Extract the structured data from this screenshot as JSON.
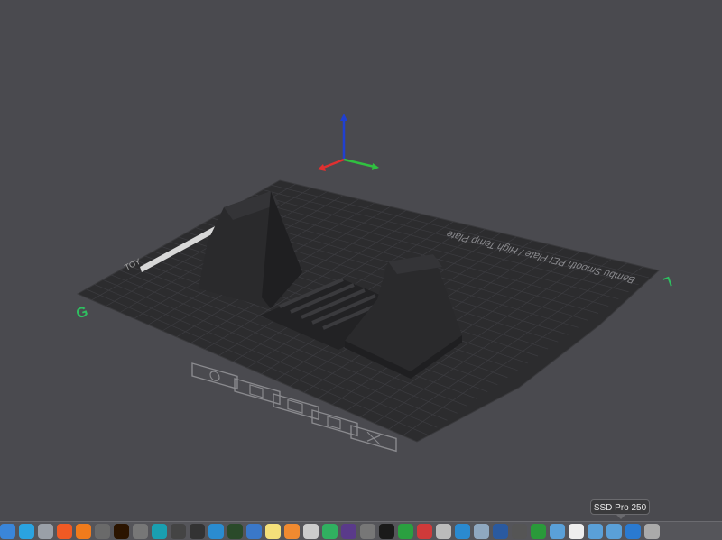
{
  "viewport": {
    "background": "#4a4a4f",
    "bed_label": "Bambu Smooth PEI Plate / High Temp Plate",
    "bed_corner_label": "TOY",
    "bed_colors": {
      "plate": "#2c2c2e",
      "grid": "#3c3c40",
      "model": "#2a2a2c"
    },
    "axis_colors": {
      "x": "#e03030",
      "y": "#30c040",
      "z": "#2040d0"
    },
    "plate_tools": [
      {
        "name": "orient-icon"
      },
      {
        "name": "arrange-icon"
      },
      {
        "name": "slice-plate-icon"
      },
      {
        "name": "settings-icon"
      },
      {
        "name": "close-icon"
      }
    ]
  },
  "tooltip": {
    "text": "SSD Pro 250"
  },
  "dock": {
    "items": [
      {
        "name": "finder-icon",
        "color": "#3a86d9"
      },
      {
        "name": "telegram-icon",
        "color": "#2aa3e0"
      },
      {
        "name": "launchpad-icon",
        "color": "#9aa0a8"
      },
      {
        "name": "brave-icon",
        "color": "#f05a24"
      },
      {
        "name": "firefox-icon",
        "color": "#f07b1c"
      },
      {
        "name": "screen-recorder-icon",
        "color": "#6a6a6a"
      },
      {
        "name": "illustrator-icon",
        "color": "#2b1400"
      },
      {
        "name": "tool-icon",
        "color": "#777"
      },
      {
        "name": "view-icon",
        "color": "#1a9fb0"
      },
      {
        "name": "block-icon",
        "color": "#444"
      },
      {
        "name": "piano-icon",
        "color": "#333"
      },
      {
        "name": "wifi-icon",
        "color": "#2a8cd0"
      },
      {
        "name": "audio-icon",
        "color": "#2a4a2a"
      },
      {
        "name": "sw-icon",
        "color": "#3a78c9"
      },
      {
        "name": "notes-icon",
        "color": "#f4e07a"
      },
      {
        "name": "finder-f-icon",
        "color": "#f08a30"
      },
      {
        "name": "text-icon",
        "color": "#ccc"
      },
      {
        "name": "green-app-icon",
        "color": "#30b060"
      },
      {
        "name": "orbit-icon",
        "color": "#5a3a8a"
      },
      {
        "name": "compass-icon",
        "color": "#777"
      },
      {
        "name": "activity-icon",
        "color": "#1a1a1a"
      },
      {
        "name": "numbers-icon",
        "color": "#2aa040"
      },
      {
        "name": "fonts-icon",
        "color": "#d03a3a"
      },
      {
        "name": "document-icon",
        "color": "#bbb"
      },
      {
        "name": "safari-icon",
        "color": "#2a8ad0"
      },
      {
        "name": "preview-icon",
        "color": "#8fa8c0"
      },
      {
        "name": "virtualbox-icon",
        "color": "#2a5aa0"
      },
      {
        "name": "system-icon",
        "color": "#555"
      },
      {
        "name": "bambu-icon",
        "color": "#2a9a3a"
      },
      {
        "name": "folder-icon",
        "color": "#5aa0d8"
      },
      {
        "name": "file-icon",
        "color": "#eee"
      },
      {
        "name": "folder2-icon",
        "color": "#5aa0d8"
      },
      {
        "name": "folder3-icon",
        "color": "#5aa0d8"
      },
      {
        "name": "cloud-icon",
        "color": "#2a7ad0"
      },
      {
        "name": "trash-icon",
        "color": "#aaa"
      }
    ]
  }
}
